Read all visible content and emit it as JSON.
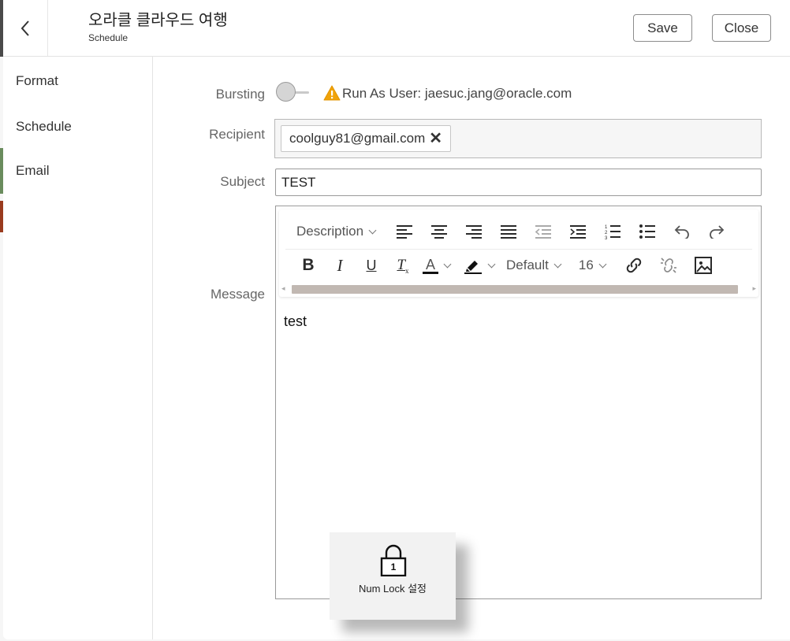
{
  "header": {
    "title": "오라클 클라우드 여행",
    "subtitle": "Schedule",
    "save_label": "Save",
    "close_label": "Close"
  },
  "sidebar": {
    "items": [
      {
        "label": "Format",
        "active": false
      },
      {
        "label": "Schedule",
        "active": false
      },
      {
        "label": "Email",
        "active": true
      }
    ]
  },
  "form": {
    "bursting_label": "Bursting",
    "bursting_on": false,
    "run_as_text": "Run As User: jaesuc.jang@oracle.com",
    "recipient_label": "Recipient",
    "recipients": [
      "coolguy81@gmail.com"
    ],
    "subject_label": "Subject",
    "subject_value": "TEST",
    "message_label": "Message",
    "message_body": "test"
  },
  "toolbar": {
    "paragraph_style": "Description",
    "font_family": "Default",
    "font_size": "16"
  },
  "osd": {
    "text": "Num Lock 설정",
    "digit": "1"
  },
  "colors": {
    "accent": "#6a8c5d",
    "warning": "#f0a30a",
    "scrollbar": "#c1b8b2"
  }
}
